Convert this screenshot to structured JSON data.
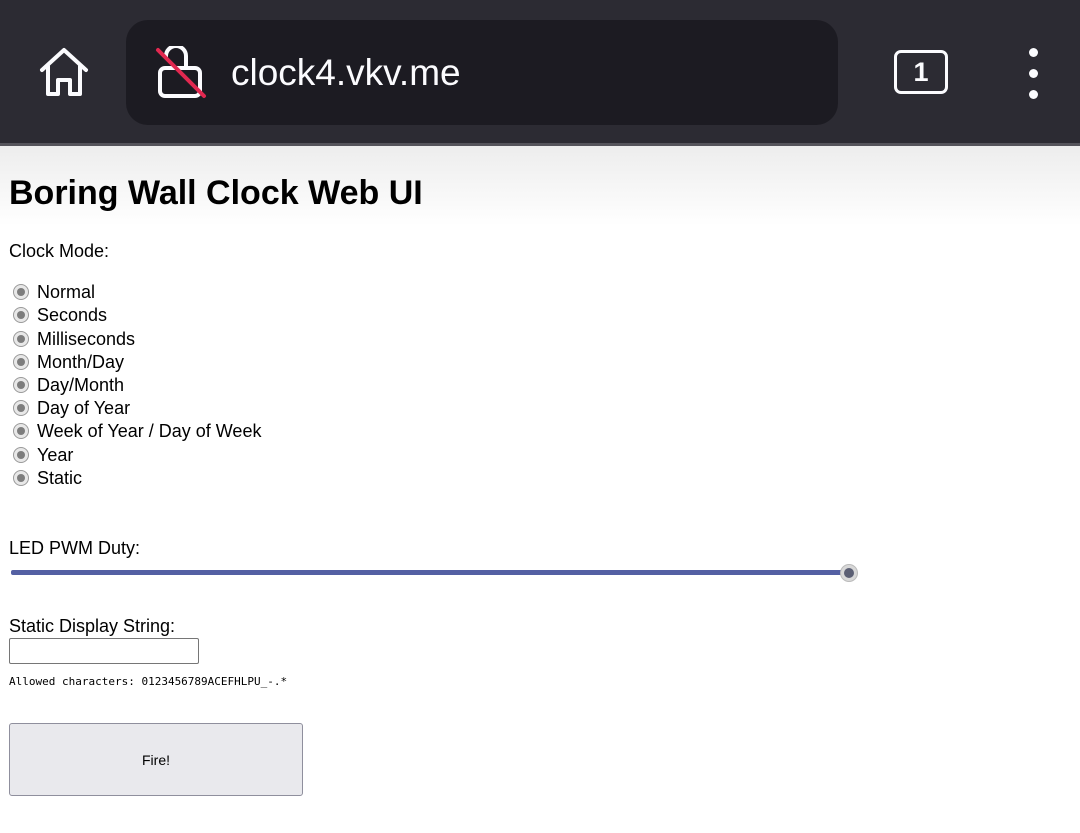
{
  "browser": {
    "url": "clock4.vkv.me",
    "tab_count": "1",
    "icons": {
      "home": "home-icon",
      "lock": "insecure-lock-icon",
      "menu": "kebab-menu-icon"
    },
    "colors": {
      "toolbar": "#2c2b33",
      "urlbar": "#1c1b22",
      "lock_strike": "#e22850"
    }
  },
  "page": {
    "title": "Boring Wall Clock Web UI",
    "clock_mode_label": "Clock Mode:",
    "modes": [
      "Normal",
      "Seconds",
      "Milliseconds",
      "Month/Day",
      "Day/Month",
      "Day of Year",
      "Week of Year / Day of Week",
      "Year",
      "Static"
    ],
    "pwm_label": "LED PWM Duty:",
    "pwm_value": 1.0,
    "static_label": "Static Display String:",
    "static_value": "",
    "allowed_chars": "Allowed characters: 0123456789ACEFHLPU_-.*",
    "fire_button": "Fire!",
    "accent": "#5460a3"
  }
}
